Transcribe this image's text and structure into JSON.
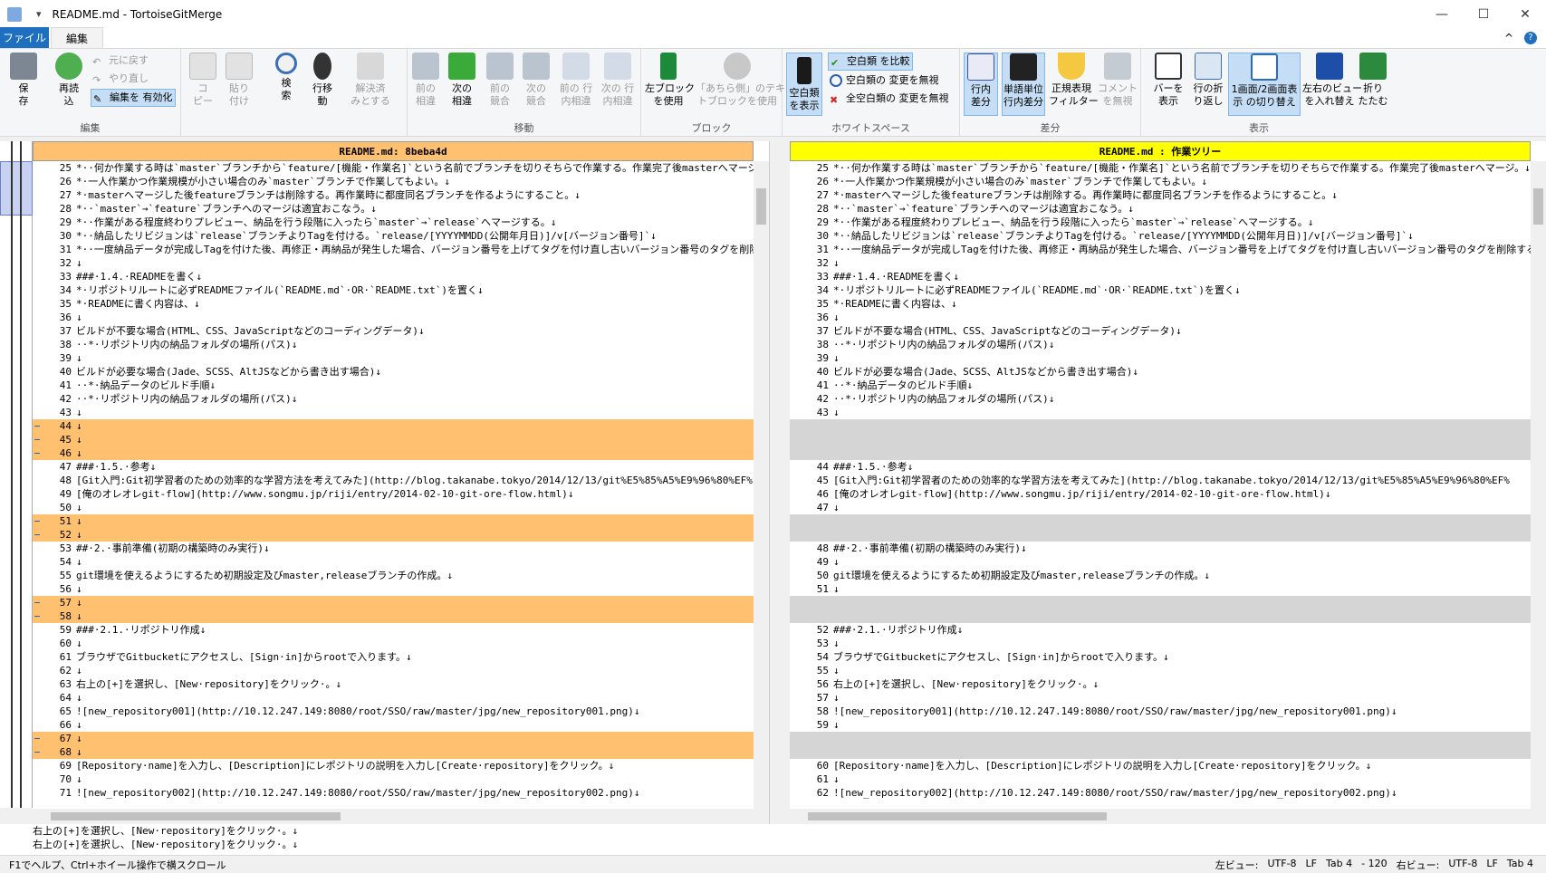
{
  "window": {
    "title": "README.md - TortoiseGitMerge"
  },
  "menu": {
    "file": "ファイル",
    "edit": "編集"
  },
  "ribbon": {
    "groups": {
      "edit": "編集",
      "nav": "移動",
      "block": "ブロック",
      "ws": "ホワイトスペース",
      "diff": "差分",
      "view": "表示"
    },
    "save": "保\n存",
    "reload": "再読\n込",
    "undo": "元に戻す",
    "redo": "やり直し",
    "enable_edit": "編集を 有効化",
    "copy": "コ\nピー",
    "paste": "貼り\n付け",
    "search": "検\n索",
    "goto_line": "行移\n動",
    "mark_resolved": "解決済\nみとする",
    "prev_diff": "前の\n相違",
    "next_diff": "次の\n相違",
    "prev_conflict": "前の\n競合",
    "next_conflict": "次の\n競合",
    "prev_inline": "前の 行\n内相違",
    "next_inline": "次の 行\n内相違",
    "use_left": "左ブロック\nを使用",
    "use_theirs": "「あちら側」のテキス\nトブロックを使用",
    "show_ws": "空白類\nを表示",
    "compare_ws": "空白類 を比較",
    "ignore_ws_change": "空白類の 変更を無視",
    "ignore_all_ws": "全空白類の 変更を無視",
    "inline_diff": "行内\n差分",
    "word_diff": "単語単位\n行内差分",
    "regex_filter": "正規表現\nフィルター",
    "ignore_comments": "コメント\nを無視",
    "show_bar": "バーを\n表示",
    "wrap": "行の折\nり返し",
    "one_two_pane": "1画面/2画面表\n示 の切り替え",
    "swap_views": "左右のビュー\nを入れ替え",
    "collapse": "折り\nたたむ"
  },
  "left_pane": {
    "header": "README.md: 8beba4d",
    "lines": [
      {
        "n": "25",
        "t": "*··何か作業する時は`master`ブランチから`feature/[機能・作業名]`という名前でブランチを切りそちらで作業する。作業完了後masterへマージ。↓",
        "k": ""
      },
      {
        "n": "26",
        "t": "*·一人作業かつ作業規模が小さい場合のみ`master`ブランチで作業してもよい。↓",
        "k": ""
      },
      {
        "n": "27",
        "t": "*·masterへマージした後featureブランチは削除する。再作業時に都度同名ブランチを作るようにすること。↓",
        "k": ""
      },
      {
        "n": "28",
        "t": "*··`master`→`feature`ブランチへのマージは適宜おこなう。↓",
        "k": ""
      },
      {
        "n": "29",
        "t": "*··作業がある程度終わりプレビュー、納品を行う段階に入ったら`master`→`release`へマージする。↓",
        "k": ""
      },
      {
        "n": "30",
        "t": "*··納品したリビジョンは`release`ブランチよりTagを付ける。`release/[YYYYMMDD(公開年月日)]/v[バージョン番号]`↓",
        "k": ""
      },
      {
        "n": "31",
        "t": "*··一度納品データが完成しTagを付けた後、再修正・再納品が発生した場合、バージョン番号を上げてタグを付け直し古いバージョン番号のタグを削除する。↓",
        "k": ""
      },
      {
        "n": "32",
        "t": "↓",
        "k": ""
      },
      {
        "n": "33",
        "t": "###·1.4.·READMEを書く↓",
        "k": ""
      },
      {
        "n": "34",
        "t": "*·リポジトリルートに必ずREADMEファイル(`README.md`·OR·`README.txt`)を置く↓",
        "k": ""
      },
      {
        "n": "35",
        "t": "*·READMEに書く内容は、↓",
        "k": ""
      },
      {
        "n": "36",
        "t": "↓",
        "k": ""
      },
      {
        "n": "37",
        "t": "ビルドが不要な場合(HTML、CSS、JavaScriptなどのコーディングデータ)↓",
        "k": ""
      },
      {
        "n": "38",
        "t": "··*·リポジトリ内の納品フォルダの場所(パス)↓",
        "k": ""
      },
      {
        "n": "39",
        "t": "↓",
        "k": ""
      },
      {
        "n": "40",
        "t": "ビルドが必要な場合(Jade、SCSS、AltJSなどから書き出す場合)↓",
        "k": ""
      },
      {
        "n": "41",
        "t": "··*·納品データのビルド手順↓",
        "k": ""
      },
      {
        "n": "42",
        "t": "··*·リポジトリ内の納品フォルダの場所(パス)↓",
        "k": ""
      },
      {
        "n": "43",
        "t": "↓",
        "k": ""
      },
      {
        "n": "44",
        "t": "↓",
        "k": "del"
      },
      {
        "n": "45",
        "t": "↓",
        "k": "del"
      },
      {
        "n": "46",
        "t": "↓",
        "k": "del"
      },
      {
        "n": "47",
        "t": "###·1.5.·参考↓",
        "k": ""
      },
      {
        "n": "48",
        "t": "[Git入門:Git初学習者のための効率的な学習方法を考えてみた](http://blog.takanabe.tokyo/2014/12/13/git%E5%85%A5%E9%96%80%EF%",
        "k": ""
      },
      {
        "n": "49",
        "t": "[俺のオレオレgit-flow](http://www.songmu.jp/riji/entry/2014-02-10-git-ore-flow.html)↓",
        "k": ""
      },
      {
        "n": "50",
        "t": "↓",
        "k": ""
      },
      {
        "n": "51",
        "t": "↓",
        "k": "del"
      },
      {
        "n": "52",
        "t": "↓",
        "k": "del"
      },
      {
        "n": "53",
        "t": "##·2.·事前準備(初期の構築時のみ実行)↓",
        "k": ""
      },
      {
        "n": "54",
        "t": "↓",
        "k": ""
      },
      {
        "n": "55",
        "t": "git環境を使えるようにするため初期設定及びmaster,releaseブランチの作成。↓",
        "k": ""
      },
      {
        "n": "56",
        "t": "↓",
        "k": ""
      },
      {
        "n": "57",
        "t": "↓",
        "k": "del"
      },
      {
        "n": "58",
        "t": "↓",
        "k": "del"
      },
      {
        "n": "59",
        "t": "###·2.1.·リポジトリ作成↓",
        "k": ""
      },
      {
        "n": "60",
        "t": "↓",
        "k": ""
      },
      {
        "n": "61",
        "t": "ブラウザでGitbucketにアクセスし、[Sign·in]からrootで入ります。↓",
        "k": ""
      },
      {
        "n": "62",
        "t": "↓",
        "k": ""
      },
      {
        "n": "63",
        "t": "右上の[+]を選択し、[New·repository]をクリック·。↓",
        "k": ""
      },
      {
        "n": "64",
        "t": "↓",
        "k": ""
      },
      {
        "n": "65",
        "t": "![new_repository001](http://10.12.247.149:8080/root/SSO/raw/master/jpg/new_repository001.png)↓",
        "k": ""
      },
      {
        "n": "66",
        "t": "↓",
        "k": ""
      },
      {
        "n": "67",
        "t": "↓",
        "k": "del"
      },
      {
        "n": "68",
        "t": "↓",
        "k": "del"
      },
      {
        "n": "69",
        "t": "[Repository·name]を入力し、[Description]にレポジトリの説明を入力し[Create·repository]をクリック。↓",
        "k": ""
      },
      {
        "n": "70",
        "t": "↓",
        "k": ""
      },
      {
        "n": "71",
        "t": "![new_repository002](http://10.12.247.149:8080/root/SSO/raw/master/jpg/new_repository002.png)↓",
        "k": ""
      }
    ]
  },
  "right_pane": {
    "header": "README.md : 作業ツリー",
    "lines": [
      {
        "n": "25",
        "t": "*··何か作業する時は`master`ブランチから`feature/[機能・作業名]`という名前でブランチを切りそちらで作業する。作業完了後masterへマージ。↓",
        "k": ""
      },
      {
        "n": "26",
        "t": "*·一人作業かつ作業規模が小さい場合のみ`master`ブランチで作業してもよい。↓",
        "k": ""
      },
      {
        "n": "27",
        "t": "*·masterへマージした後featureブランチは削除する。再作業時に都度同名ブランチを作るようにすること。↓",
        "k": ""
      },
      {
        "n": "28",
        "t": "*··`master`→`feature`ブランチへのマージは適宜おこなう。↓",
        "k": ""
      },
      {
        "n": "29",
        "t": "*··作業がある程度終わりプレビュー、納品を行う段階に入ったら`master`→`release`へマージする。↓",
        "k": ""
      },
      {
        "n": "30",
        "t": "*··納品したリビジョンは`release`ブランチよりTagを付ける。`release/[YYYYMMDD(公開年月日)]/v[バージョン番号]`↓",
        "k": ""
      },
      {
        "n": "31",
        "t": "*··一度納品データが完成しTagを付けた後、再修正・再納品が発生した場合、バージョン番号を上げてタグを付け直し古いバージョン番号のタグを削除する。↓",
        "k": ""
      },
      {
        "n": "32",
        "t": "↓",
        "k": ""
      },
      {
        "n": "33",
        "t": "###·1.4.·READMEを書く↓",
        "k": ""
      },
      {
        "n": "34",
        "t": "*·リポジトリルートに必ずREADMEファイル(`README.md`·OR·`README.txt`)を置く↓",
        "k": ""
      },
      {
        "n": "35",
        "t": "*·READMEに書く内容は、↓",
        "k": ""
      },
      {
        "n": "36",
        "t": "↓",
        "k": ""
      },
      {
        "n": "37",
        "t": "ビルドが不要な場合(HTML、CSS、JavaScriptなどのコーディングデータ)↓",
        "k": ""
      },
      {
        "n": "38",
        "t": "··*·リポジトリ内の納品フォルダの場所(パス)↓",
        "k": ""
      },
      {
        "n": "39",
        "t": "↓",
        "k": ""
      },
      {
        "n": "40",
        "t": "ビルドが必要な場合(Jade、SCSS、AltJSなどから書き出す場合)↓",
        "k": ""
      },
      {
        "n": "41",
        "t": "··*·納品データのビルド手順↓",
        "k": ""
      },
      {
        "n": "42",
        "t": "··*·リポジトリ内の納品フォルダの場所(パス)↓",
        "k": ""
      },
      {
        "n": "43",
        "t": "↓",
        "k": ""
      },
      {
        "n": "",
        "t": "",
        "k": "pad"
      },
      {
        "n": "",
        "t": "",
        "k": "pad"
      },
      {
        "n": "",
        "t": "",
        "k": "pad"
      },
      {
        "n": "44",
        "t": "###·1.5.·参考↓",
        "k": ""
      },
      {
        "n": "45",
        "t": "[Git入門:Git初学習者のための効率的な学習方法を考えてみた](http://blog.takanabe.tokyo/2014/12/13/git%E5%85%A5%E9%96%80%EF%",
        "k": ""
      },
      {
        "n": "46",
        "t": "[俺のオレオレgit-flow](http://www.songmu.jp/riji/entry/2014-02-10-git-ore-flow.html)↓",
        "k": ""
      },
      {
        "n": "47",
        "t": "↓",
        "k": ""
      },
      {
        "n": "",
        "t": "",
        "k": "pad"
      },
      {
        "n": "",
        "t": "",
        "k": "pad"
      },
      {
        "n": "48",
        "t": "##·2.·事前準備(初期の構築時のみ実行)↓",
        "k": ""
      },
      {
        "n": "49",
        "t": "↓",
        "k": ""
      },
      {
        "n": "50",
        "t": "git環境を使えるようにするため初期設定及びmaster,releaseブランチの作成。↓",
        "k": ""
      },
      {
        "n": "51",
        "t": "↓",
        "k": ""
      },
      {
        "n": "",
        "t": "",
        "k": "pad"
      },
      {
        "n": "",
        "t": "",
        "k": "pad"
      },
      {
        "n": "52",
        "t": "###·2.1.·リポジトリ作成↓",
        "k": ""
      },
      {
        "n": "53",
        "t": "↓",
        "k": ""
      },
      {
        "n": "54",
        "t": "ブラウザでGitbucketにアクセスし、[Sign·in]からrootで入ります。↓",
        "k": ""
      },
      {
        "n": "55",
        "t": "↓",
        "k": ""
      },
      {
        "n": "56",
        "t": "右上の[+]を選択し、[New·repository]をクリック·。↓",
        "k": ""
      },
      {
        "n": "57",
        "t": "↓",
        "k": ""
      },
      {
        "n": "58",
        "t": "![new_repository001](http://10.12.247.149:8080/root/SSO/raw/master/jpg/new_repository001.png)↓",
        "k": ""
      },
      {
        "n": "59",
        "t": "↓",
        "k": ""
      },
      {
        "n": "",
        "t": "",
        "k": "pad"
      },
      {
        "n": "",
        "t": "",
        "k": "pad"
      },
      {
        "n": "60",
        "t": "[Repository·name]を入力し、[Description]にレポジトリの説明を入力し[Create·repository]をクリック。↓",
        "k": ""
      },
      {
        "n": "61",
        "t": "↓",
        "k": ""
      },
      {
        "n": "62",
        "t": "![new_repository002](http://10.12.247.149:8080/root/SSO/raw/master/jpg/new_repository002.png)↓",
        "k": ""
      }
    ]
  },
  "bottom_view": {
    "line1": "右上の[+]を選択し、[New·repository]をクリック·。↓",
    "line2": "右上の[+]を選択し、[New·repository]をクリック·。↓"
  },
  "status": {
    "help": "F1でヘルプ、Ctrl+ホイール操作で横スクロール",
    "left_label": "左ビュー:",
    "left_enc": "UTF-8",
    "left_eol": "LF",
    "left_tab": "Tab 4",
    "left_diff": "- 120",
    "right_label": "右ビュー:",
    "right_enc": "UTF-8",
    "right_eol": "LF",
    "right_tab": "Tab 4"
  },
  "colors": {
    "left_header": "#ffc16f",
    "right_header": "#ffff00",
    "removed": "#ffc16f",
    "padding": "#d5d5d5",
    "accent": "#1e6fc0"
  }
}
